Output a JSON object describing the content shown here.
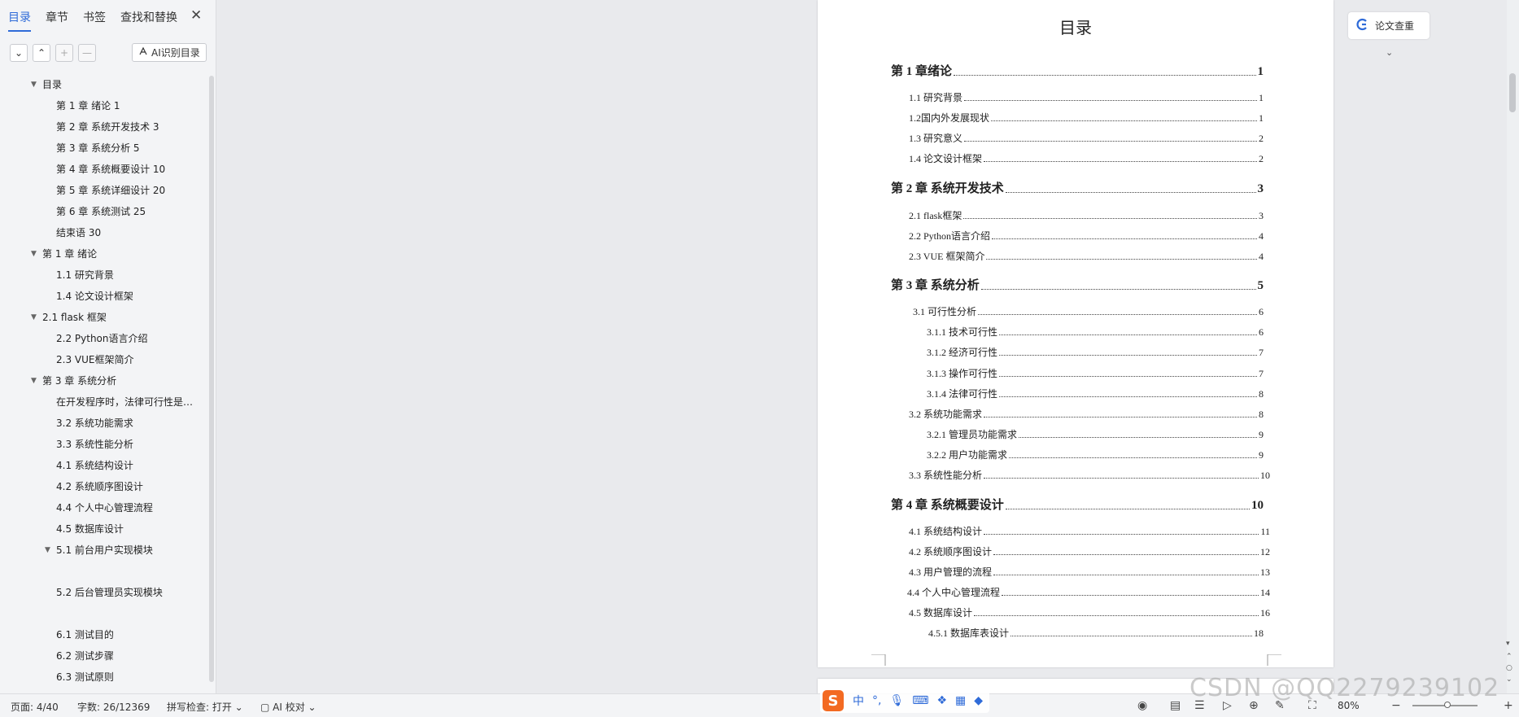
{
  "sidebar": {
    "tabs": [
      "目录",
      "章节",
      "书签",
      "查找和替换"
    ],
    "close_glyph": "✕",
    "toolbar": {
      "expand_glyph": "⌄",
      "collapse_glyph": "⌃",
      "add_glyph": "+",
      "remove_glyph": "—",
      "ai_label": "AI识别目录"
    },
    "tree": [
      {
        "label": "目录",
        "level": 0,
        "expanded": true
      },
      {
        "label": "第 1 章 绪论 1",
        "level": 1
      },
      {
        "label": "第 2 章 系统开发技术   3",
        "level": 1
      },
      {
        "label": "第 3 章 系统分析 5",
        "level": 1
      },
      {
        "label": "第 4 章 系统概要设计 10",
        "level": 1
      },
      {
        "label": "第 5 章 系统详细设计 20",
        "level": 1
      },
      {
        "label": "第 6 章 系统测试 25",
        "level": 1
      },
      {
        "label": "结束语 30",
        "level": 1
      },
      {
        "label": "第 1 章 绪论",
        "level": 0,
        "expanded": true
      },
      {
        "label": "1.1 研究背景",
        "level": 1
      },
      {
        "label": "1.4 论文设计框架",
        "level": 1
      },
      {
        "label": "2.1 flask 框架",
        "level": 0,
        "expanded": true
      },
      {
        "label": "2.2 Python语言介绍",
        "level": 1
      },
      {
        "label": "2.3 VUE框架简介",
        "level": 1
      },
      {
        "label": "第 3 章 系统分析",
        "level": 0,
        "expanded": true
      },
      {
        "label": "在开发程序时，法律可行性是…",
        "level": 1
      },
      {
        "label": "3.2 系统功能需求",
        "level": 1
      },
      {
        "label": "3.3 系统性能分析",
        "level": 1
      },
      {
        "label": "4.1 系统结构设计",
        "level": 1
      },
      {
        "label": "4.2 系统顺序图设计",
        "level": 1
      },
      {
        "label": "4.4 个人中心管理流程",
        "level": 1
      },
      {
        "label": "4.5 数据库设计",
        "level": 1
      },
      {
        "label": "5.1 前台用户实现模块",
        "level": 1,
        "expanded": true
      },
      {
        "label": "5.2 后台管理员实现模块",
        "level": 1
      },
      {
        "label": "6.1 测试目的",
        "level": 1
      },
      {
        "label": "6.2 测试步骤",
        "level": 1
      },
      {
        "label": "6.3 测试原则",
        "level": 1
      }
    ]
  },
  "document": {
    "toc_title": "目录",
    "toc": [
      {
        "text": "第 1  章绪论",
        "page": "1",
        "level": 1
      },
      {
        "text": "1.1  研究背景",
        "page": "1",
        "level": 2
      },
      {
        "text": "1.2国内外发展现状",
        "page": "1",
        "level": 2
      },
      {
        "text": "1.3  研究意义",
        "page": "2",
        "level": 2
      },
      {
        "text": "1.4  论文设计框架",
        "page": "2",
        "level": 2
      },
      {
        "text": "第 2  章  系统开发技术",
        "page": "3",
        "level": 1
      },
      {
        "text": "2.1 flask框架",
        "page": "3",
        "level": 2
      },
      {
        "text": "2.2 Python语言介绍",
        "page": "4",
        "level": 2
      },
      {
        "text": "2.3 VUE 框架简介",
        "page": "4",
        "level": 2
      },
      {
        "text": "第 3  章  系统分析",
        "page": "5",
        "level": 1
      },
      {
        "text": "3.1  可行性分析",
        "page": "6",
        "level": 2
      },
      {
        "text": "3.1.1  技术可行性",
        "page": "6",
        "level": 3
      },
      {
        "text": "3.1.2  经济可行性",
        "page": "7",
        "level": 3
      },
      {
        "text": "3.1.3  操作可行性",
        "page": "7",
        "level": 3
      },
      {
        "text": "3.1.4  法律可行性",
        "page": "8",
        "level": 3
      },
      {
        "text": "3.2  系统功能需求",
        "page": "8",
        "level": 2
      },
      {
        "text": "3.2.1  管理员功能需求",
        "page": "9",
        "level": 3
      },
      {
        "text": "3.2.2  用户功能需求",
        "page": "9",
        "level": 3
      },
      {
        "text": "3.3  系统性能分析",
        "page": "10",
        "level": 2
      },
      {
        "text": "第 4  章  系统概要设计",
        "page": "10",
        "level": 1
      },
      {
        "text": "4.1  系统结构设计",
        "page": "11",
        "level": 2
      },
      {
        "text": "4.2  系统顺序图设计",
        "page": "12",
        "level": 2
      },
      {
        "text": "4.3  用户管理的流程",
        "page": "13",
        "level": 2
      },
      {
        "text": "4.4  个人中心管理流程",
        "page": "14",
        "level": 2
      },
      {
        "text": "4.5  数据库设计",
        "page": "16",
        "level": 2
      },
      {
        "text": "4.5.1  数据库表设计",
        "page": "18",
        "level": 3
      }
    ]
  },
  "right_panel": {
    "plagiarism_check_label": "论文查重",
    "chevron_glyph": "⌄"
  },
  "statusbar": {
    "page": "页面: 4/40",
    "words": "字数: 26/12369",
    "spellcheck": "拼写检查: 打开 ⌄",
    "ai_check": "AI 校对 ⌄",
    "zoom": "80%"
  },
  "ime": {
    "logo": "S",
    "lang": "中",
    "punct": "°,"
  },
  "watermark": "CSDN @QQ2279239102",
  "colors": {
    "accent": "#2f6bd8",
    "ime_orange": "#f36a22"
  }
}
